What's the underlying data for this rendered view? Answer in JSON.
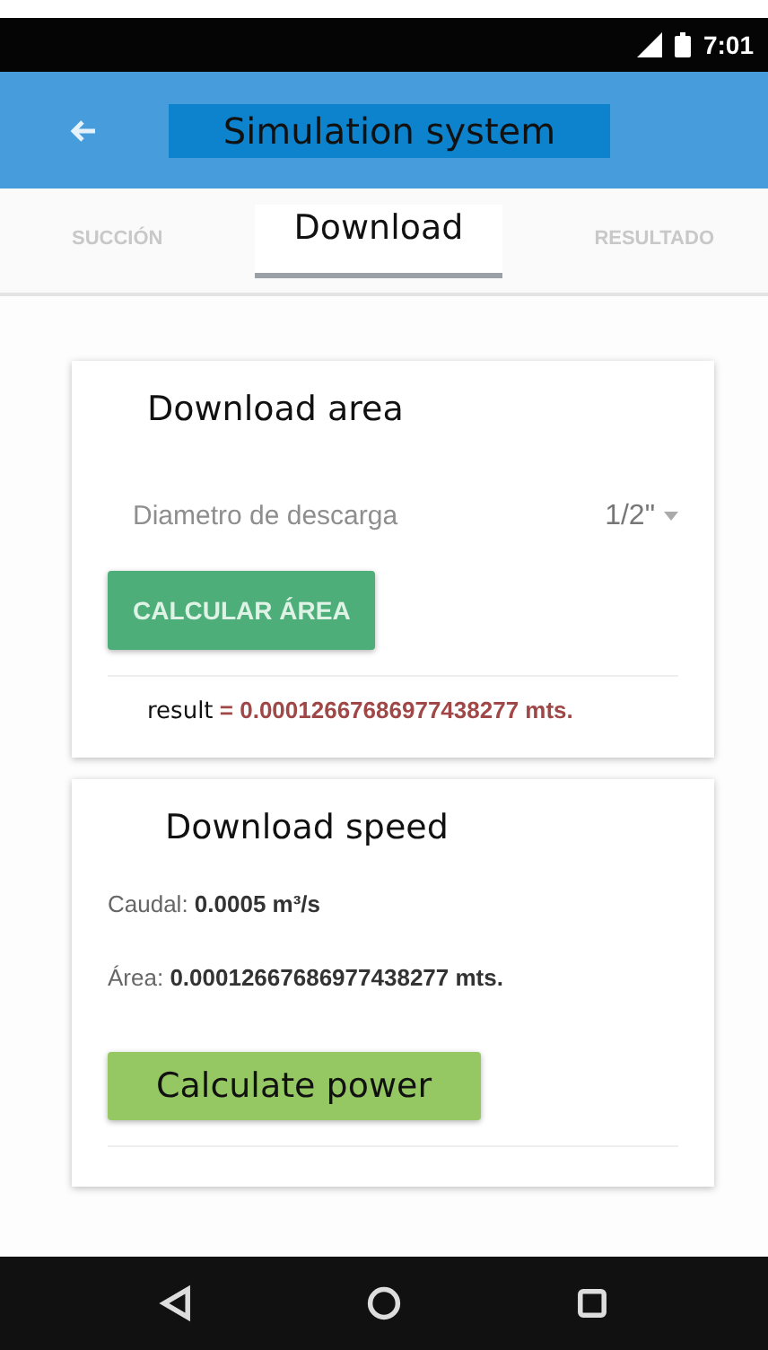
{
  "status_bar": {
    "time": "7:01"
  },
  "app_bar": {
    "title": "Simulation system"
  },
  "tabs": [
    {
      "label": "SUCCIÓN",
      "selected": false
    },
    {
      "label": "Download",
      "selected": true
    },
    {
      "label": "RESULTADO",
      "selected": false
    }
  ],
  "area_card": {
    "title": "Download area",
    "field": {
      "placeholder": "Diametro de descarga"
    },
    "dropdown": {
      "value": "1/2\""
    },
    "button": "CALCULAR ÁREA",
    "result_label": "result",
    "result_value": "= 0.00012667686977438277 mts."
  },
  "speed_card": {
    "title": "Download speed",
    "lines": [
      "Caudal: **0.0005 m³/s**",
      "Área: **0.00012667686977438277 mts.**"
    ],
    "button": "Calculate power"
  }
}
